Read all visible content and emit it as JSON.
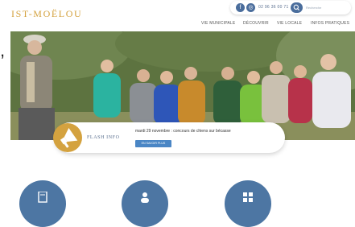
{
  "site": {
    "logo_text": "IST-MOËLOU"
  },
  "header": {
    "phone": "02 96 36 00 71",
    "search_placeholder": "Recherche",
    "social": [
      "facebook-icon",
      "instagram-icon"
    ]
  },
  "nav": {
    "items": [
      "VIE MUNICIPALE",
      "DÉCOUVRIR",
      "VIE LOCALE",
      "INFOS PRATIQUES"
    ]
  },
  "left_mark": ",",
  "flash": {
    "label": "FLASH INFO",
    "text": "mardi 29 novembre : concours de chiens sur bécasse",
    "button": "EN SAVOIR PLUS",
    "icon": "megaphone-icon"
  },
  "quick_links": {
    "icons": [
      "document-icon",
      "person-icon",
      "grid-icon"
    ]
  },
  "colors": {
    "accent_gold": "#d4a23f",
    "brand_blue": "#4a6d9c",
    "button_blue": "#4a86c5"
  }
}
